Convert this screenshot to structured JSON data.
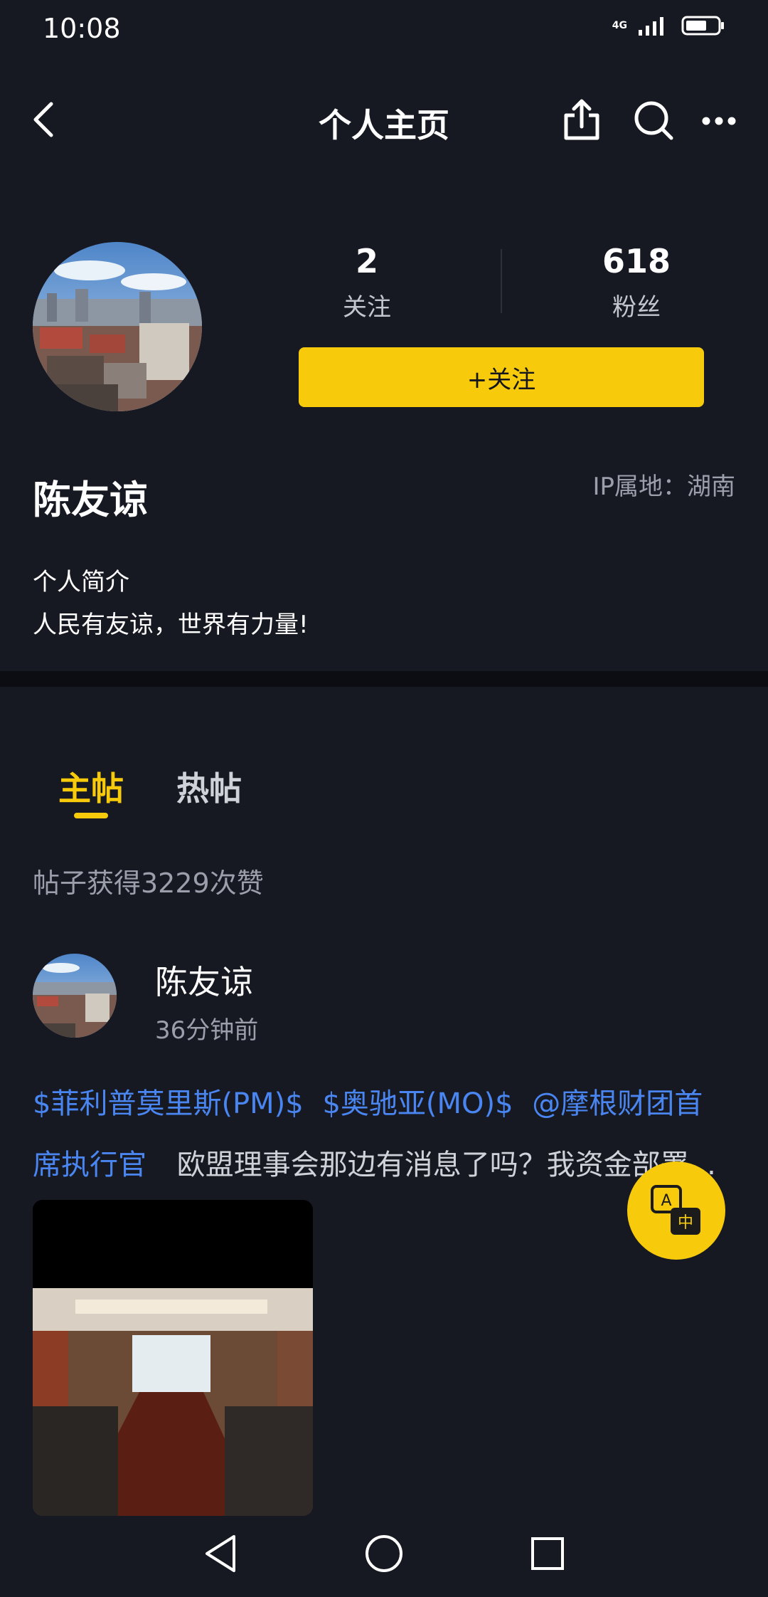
{
  "status_bar": {
    "time": "10:08",
    "network": "4G"
  },
  "nav": {
    "title": "个人主页"
  },
  "profile": {
    "following_count": "2",
    "following_label": "关注",
    "followers_count": "618",
    "followers_label": "粉丝",
    "follow_button": "+关注",
    "name": "陈友谅",
    "ip_location": "IP属地：湖南",
    "bio_title": "个人简介",
    "bio_text": "人民有友谅，世界有力量!"
  },
  "tabs": [
    {
      "label": "主帖",
      "active": true
    },
    {
      "label": "热帖",
      "active": false
    }
  ],
  "likes_summary": "帖子获得3229次赞",
  "post": {
    "author": "陈友谅",
    "time": "36分钟前",
    "tags": [
      "$菲利普莫里斯(PM)$",
      "$奥驰亚(MO)$",
      "@摩根财团首",
      "席执行官"
    ],
    "text": "欧盟理事会那边有消息了吗？我资金部署..."
  },
  "colors": {
    "accent": "#f7cb0b",
    "link": "#4a86f2",
    "background": "#171922"
  },
  "icons": [
    "back-icon",
    "share-icon",
    "search-icon",
    "more-icon",
    "translate-icon",
    "nav-back-icon",
    "nav-home-icon",
    "nav-recents-icon"
  ]
}
